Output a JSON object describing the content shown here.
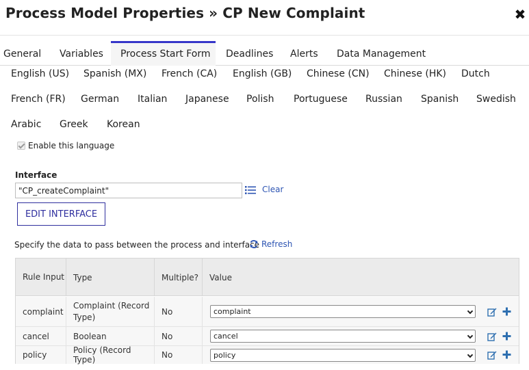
{
  "title": "Process Model Properties » CP New Complaint",
  "tabs": [
    "General",
    "Variables",
    "Process Start Form",
    "Deadlines",
    "Alerts",
    "Data Management"
  ],
  "active_tab": "Process Start Form",
  "languages": [
    "English (US)",
    "Spanish (MX)",
    "French (CA)",
    "English (GB)",
    "Chinese (CN)",
    "Chinese (HK)",
    "Dutch",
    "French (FR)",
    "German",
    "Italian",
    "Japanese",
    "Polish",
    "Portuguese",
    "Russian",
    "Spanish",
    "Swedish",
    "Arabic",
    "Greek",
    "Korean"
  ],
  "enable_language": "Enable this language",
  "interface": {
    "label": "Interface",
    "value": "\"CP_createComplaint\"",
    "clear": "Clear",
    "edit_button": "EDIT INTERFACE"
  },
  "spec_text": "Specify the data to pass between the process and interface",
  "refresh": "Refresh",
  "grid": {
    "headers": [
      "Rule Input",
      "Type",
      "Multiple?",
      "Value"
    ],
    "rows": [
      {
        "input": "complaint",
        "type": "Complaint (Record Type)",
        "multiple": "No",
        "value": "complaint"
      },
      {
        "input": "cancel",
        "type": "Boolean",
        "multiple": "No",
        "value": "cancel"
      },
      {
        "input": "policy",
        "type": "Policy (Record Type)",
        "multiple": "No",
        "value": "policy"
      }
    ]
  },
  "colors": {
    "accent": "#3535c9",
    "link": "#2e55b3"
  },
  "icons": [
    "close-icon",
    "list-icon",
    "refresh-icon",
    "edit-icon",
    "add-icon",
    "chevron-down-icon"
  ]
}
